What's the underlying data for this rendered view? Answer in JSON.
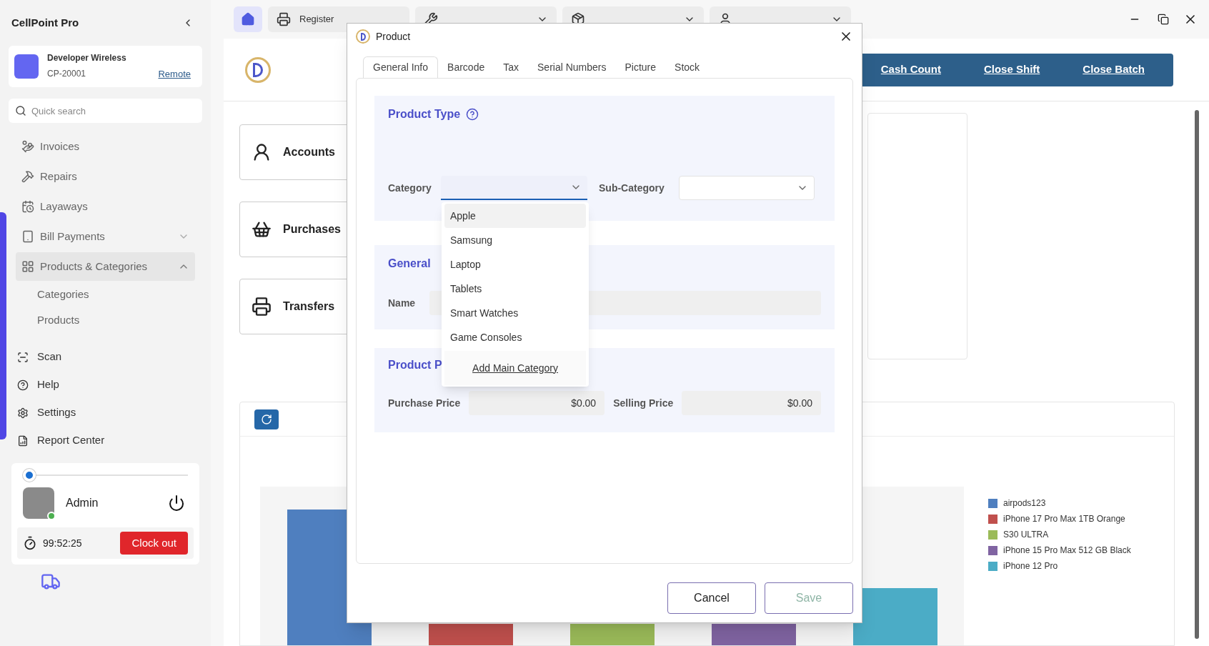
{
  "sidebar": {
    "app_title": "CellPoint Pro",
    "store": {
      "name": "Developer Wireless",
      "code": "CP-20001",
      "link": "Remote"
    },
    "search": {
      "placeholder": "Quick search"
    },
    "items": [
      {
        "label": "Invoices",
        "kind": "link",
        "selected": false
      },
      {
        "label": "Repairs",
        "kind": "link",
        "selected": false
      },
      {
        "label": "Layaways",
        "kind": "link",
        "selected": false
      },
      {
        "label": "Bill Payments",
        "kind": "group",
        "selected": false,
        "expanded": false
      },
      {
        "label": "Products & Categories",
        "kind": "group",
        "selected": true,
        "expanded": true,
        "children": [
          {
            "label": "Categories"
          },
          {
            "label": "Products"
          }
        ]
      }
    ],
    "tools": [
      {
        "label": "Scan"
      },
      {
        "label": "Help"
      },
      {
        "label": "Settings"
      },
      {
        "label": "Report Center"
      }
    ],
    "user": {
      "level": 0,
      "name": "Admin",
      "online": true,
      "timer": "99:52:25",
      "clock_button": "Clock out"
    }
  },
  "topbar": {
    "home_selected": true,
    "tabs": [
      {
        "label": "Register",
        "kind": "plain",
        "selected": false
      },
      {
        "kind": "dropdown",
        "selected": false
      },
      {
        "kind": "dropdown",
        "selected": false
      },
      {
        "kind": "dropdown",
        "selected": false
      }
    ]
  },
  "actions": [
    "Cash Count",
    "Close Shift",
    "Close Batch"
  ],
  "cards": [
    "Accounts",
    "Purchases",
    "Transfers"
  ],
  "chart_legend": [
    {
      "label": "airpods123",
      "color": "#4f7fbf"
    },
    {
      "label": "iPhone 17 Pro Max 1TB Orange",
      "color": "#c0504d"
    },
    {
      "label": "S30 ULTRA",
      "color": "#9bbb59"
    },
    {
      "label": "iPhone 15 Pro Max 512 GB Black",
      "color": "#8064a2"
    },
    {
      "label": "iPhone 12 Pro",
      "color": "#4bacc6"
    }
  ],
  "dialog": {
    "title": "Product",
    "tabs": [
      {
        "label": "General Info",
        "selected": true
      },
      {
        "label": "Barcode",
        "selected": false
      },
      {
        "label": "Tax",
        "selected": false
      },
      {
        "label": "Serial Numbers",
        "selected": false
      },
      {
        "label": "Picture",
        "selected": false
      },
      {
        "label": "Stock",
        "selected": false
      }
    ],
    "product_type": {
      "heading": "Product Type",
      "category_label": "Category",
      "category_focused": true,
      "subcategory_label": "Sub-Category"
    },
    "general": {
      "heading": "General",
      "name_label": "Name"
    },
    "price": {
      "heading": "Product P",
      "purchase_label": "Purchase Price",
      "purchase_value": "$0.00",
      "selling_label": "Selling Price",
      "selling_value": "$0.00"
    },
    "dropdown": {
      "options": [
        {
          "label": "Apple",
          "selected": true
        },
        {
          "label": "Samsung",
          "selected": false
        },
        {
          "label": "Laptop",
          "selected": false
        },
        {
          "label": "Tablets",
          "selected": false
        },
        {
          "label": "Smart Watches",
          "selected": false
        },
        {
          "label": "Game Consoles",
          "selected": false
        }
      ],
      "add_link": "Add Main Category"
    },
    "buttons": {
      "cancel": "Cancel",
      "save": "Save",
      "save_disabled": true
    }
  }
}
